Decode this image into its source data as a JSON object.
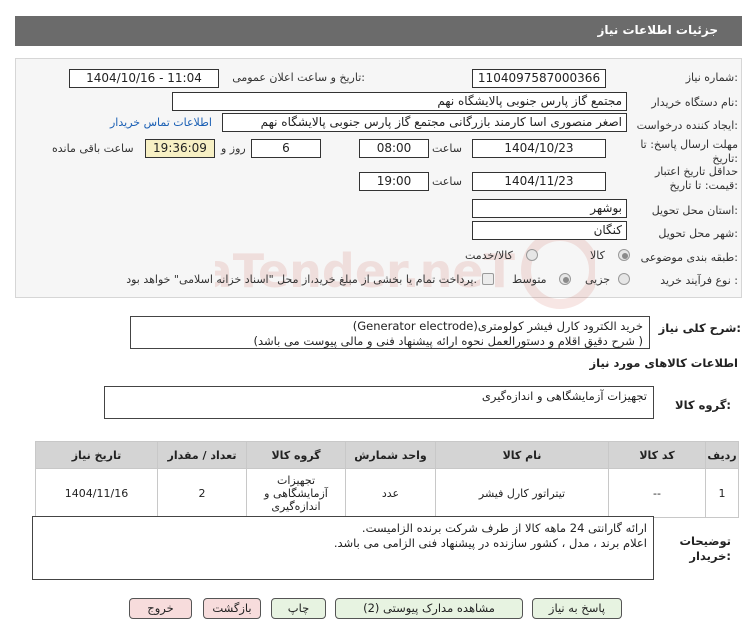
{
  "header": {
    "title": "جزئیات اطلاعات نیاز"
  },
  "form": {
    "need_number_label": "شماره نیاز:",
    "need_number": "1104097587000366",
    "announce_label": "تاریخ و ساعت اعلان عمومی:",
    "announce_value": "1404/10/16 - 11:04",
    "buyer_org_label": "نام دستگاه خریدار:",
    "buyer_org": "مجتمع گاز پارس جنوبی  پالایشگاه نهم",
    "creator_label": "ایجاد کننده درخواست:",
    "creator": "اصغر منصوری اسا کارمند بازرگانی مجتمع گاز پارس جنوبی  پالایشگاه نهم",
    "contact_link": "اطلاعات تماس خریدار",
    "deadline_label": "مهلت ارسال پاسخ: تا تاریخ:",
    "deadline_date": "1404/10/23",
    "time_label": "ساعت",
    "deadline_time": "08:00",
    "days_value": "6",
    "days_label": "روز و",
    "remaining_time": "19:36:09",
    "remaining_label": "ساعت باقی مانده",
    "validity_label": "حداقل تاریخ اعتبار قیمت: تا تاریخ:",
    "validity_date": "1404/11/23",
    "validity_time": "19:00",
    "province_label": "استان محل تحویل:",
    "province": "بوشهر",
    "city_label": "شهر محل تحویل:",
    "city": "کنگان",
    "category_label": "طبقه بندی موضوعی:",
    "category_options": [
      "کالا",
      "کالا/خدمت"
    ],
    "purchase_type_label": "نوع فرآیند خرید :",
    "purchase_type_options": [
      "جزیی",
      "متوسط"
    ],
    "purchase_note": "پرداخت تمام یا بخشی از مبلغ خرید،از محل \"اسناد خزانه اسلامی\" خواهد بود."
  },
  "description": {
    "label": "شرح کلی نیاز:",
    "line1": "خرید الکترود کارل فیشر کولومتری(Generator electrode)",
    "line2": "( شرح دقیق اقلام و دستورالعمل نحوه ارائه پیشنهاد فنی و مالی پیوست می باشد)"
  },
  "goods": {
    "section_title": "اطلاعات کالاهای مورد نیاز",
    "group_label": "گروه کالا:",
    "group_value": "تجهیزات آزمایشگاهی و اندازه‌گیری"
  },
  "table": {
    "headers": [
      "ردیف",
      "کد کالا",
      "نام کالا",
      "واحد شمارش",
      "گروه کالا",
      "تعداد / مقدار",
      "تاریخ نیاز"
    ],
    "row": {
      "index": "1",
      "code": "--",
      "name": "تیتراتور کارل فیشر",
      "unit": "عدد",
      "group_l1": "تجهیزات",
      "group_l2": "آزمایشگاهی و",
      "group_l3": "اندازه‌گیری",
      "qty": "2",
      "date": "1404/11/16"
    }
  },
  "buyer_notes": {
    "label_l1": "توضیحات",
    "label_l2": "خریدار:",
    "line1": "ارائه گارانتی 24 ماهه کالا از طرف شرکت برنده الزامیست.",
    "line2": "اعلام برند ، مدل ، کشور سازنده در پیشنهاد فنی الزامی می باشد."
  },
  "buttons": {
    "reply": "پاسخ به نیاز",
    "docs": "مشاهده مدارک پیوستی (2)",
    "print": "چاپ",
    "back": "بازگشت",
    "exit": "خروج"
  },
  "watermark": {
    "text": "AriaTender.neT"
  },
  "colors": {
    "header_bg": "#6b6b6b",
    "highlight": "#f7f0c4",
    "link": "#1a5fb4",
    "button_green": "#e7f3e1",
    "button_red": "#f7dcdc"
  }
}
